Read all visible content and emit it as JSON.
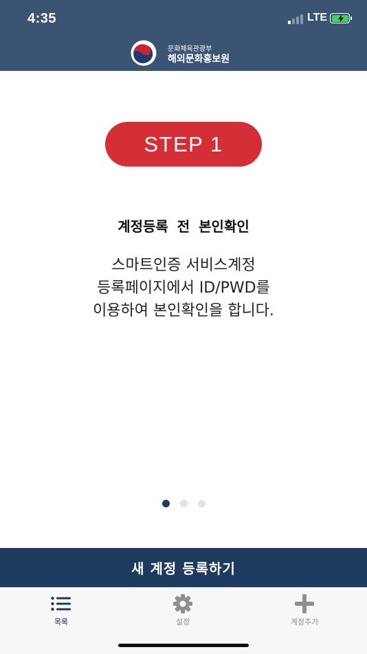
{
  "status_bar": {
    "time": "4:35",
    "network": "LTE"
  },
  "header": {
    "org_sub": "문화체육관광부",
    "org_main": "해외문화홍보원",
    "logo_icon": "taegeuk-logo-icon"
  },
  "onboarding": {
    "step_label": "STEP 1",
    "title": "계정등록 전 본인확인",
    "description_lines": [
      "스마트인증 서비스계정",
      "등록페이지에서 ID/PWD를",
      "이용하여 본인확인을 합니다."
    ],
    "page_count": 3,
    "current_page": 1
  },
  "register_button": {
    "label": "새 계정 등록하기"
  },
  "tab_bar": {
    "items": [
      {
        "label": "목록",
        "icon": "list-icon",
        "active": true
      },
      {
        "label": "설정",
        "icon": "gear-icon",
        "active": false
      },
      {
        "label": "계정추가",
        "icon": "plus-icon",
        "active": false
      }
    ]
  },
  "colors": {
    "header_bg": "#3c5474",
    "step_pill": "#d42f37",
    "primary_navy": "#1d3a5f",
    "inactive_gray": "#8e8e93"
  }
}
